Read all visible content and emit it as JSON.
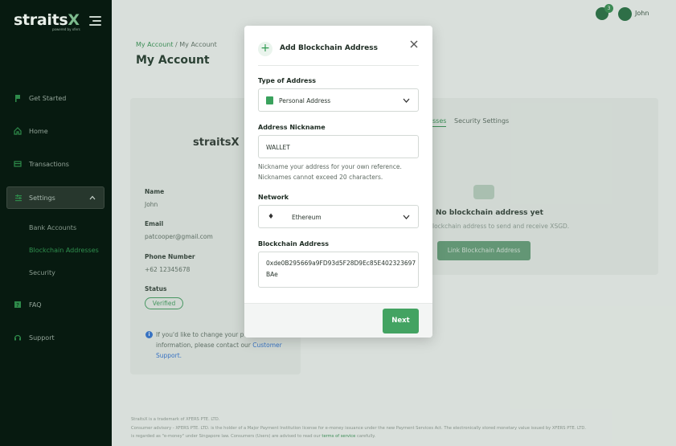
{
  "sidebar": {
    "brand": "straits",
    "brand_x": "X",
    "brand_sub": "powered by xfers",
    "items": [
      {
        "label": "Get Started",
        "icon": "flag-icon"
      },
      {
        "label": "Home",
        "icon": "home-icon"
      },
      {
        "label": "Transactions",
        "icon": "transactions-icon"
      },
      {
        "label": "Settings",
        "icon": "settings-icon"
      },
      {
        "label": "FAQ",
        "icon": "faq-icon"
      },
      {
        "label": "Support",
        "icon": "headset-icon"
      }
    ],
    "sub_items": [
      "Bank Accounts",
      "Blockchain Addresses",
      "Security"
    ]
  },
  "topbar": {
    "notification_count": "3",
    "user_name": "John"
  },
  "page": {
    "breadcrumb_link": "My Account",
    "breadcrumb_sep": "/",
    "breadcrumb_current": "My Account",
    "title": "My Account"
  },
  "profile": {
    "logo": "straitsX",
    "name_label": "Name",
    "name_value": "John",
    "email_label": "Email",
    "email_value": "patcooper@gmail.com",
    "phone_label": "Phone Number",
    "phone_value": "+62 12345678",
    "status_label": "Status",
    "status_value": "Verified",
    "note_text": "If you'd like to change your p",
    "note_text2": "information, please contact our",
    "note_link": "Customer",
    "note_link2": "Support."
  },
  "tabs": {
    "active_fragment": "sses",
    "inactive": "Security Settings"
  },
  "empty_state": {
    "title": "No blockchain address yet",
    "subtitle": "lockchain address to send and receive XSGD.",
    "button": "Link Blockchain Address"
  },
  "footer": {
    "line1": "StraitsX is a trademark of XFERS PTE. LTD.",
    "line2": "Consumer advisory - XFERS PTE. LTD. is the holder of a Major Payment Institution license for e-money issuance under the new Payment Services Act. The electronically stored monetary value issued by XFERS PTE. LTD.",
    "line3_pre": "is regarded as \"e-money\" under Singapore law. Consumers (Users) are advised to read our ",
    "line3_link": "terms of service",
    "line3_post": " carefully."
  },
  "modal": {
    "title": "Add Blockchain Address",
    "type_label": "Type of Address",
    "type_value": "Personal Address",
    "nickname_label": "Address Nickname",
    "nickname_value": "WALLET",
    "helper_line1": "Nickname your address for your own reference.",
    "helper_line2": "Nicknames cannot exceed 20 characters.",
    "network_label": "Network",
    "network_value": "Ethereum",
    "address_label": "Blockchain Address",
    "address_line1": "0xde0B295669a9FD93d5F28D9Ec85E402323697",
    "address_line2": "BAe",
    "next_button": "Next"
  },
  "colors": {
    "sidebar_bg": "#071a10",
    "accent_green": "#43a362",
    "link_blue": "#2a6fd1"
  }
}
